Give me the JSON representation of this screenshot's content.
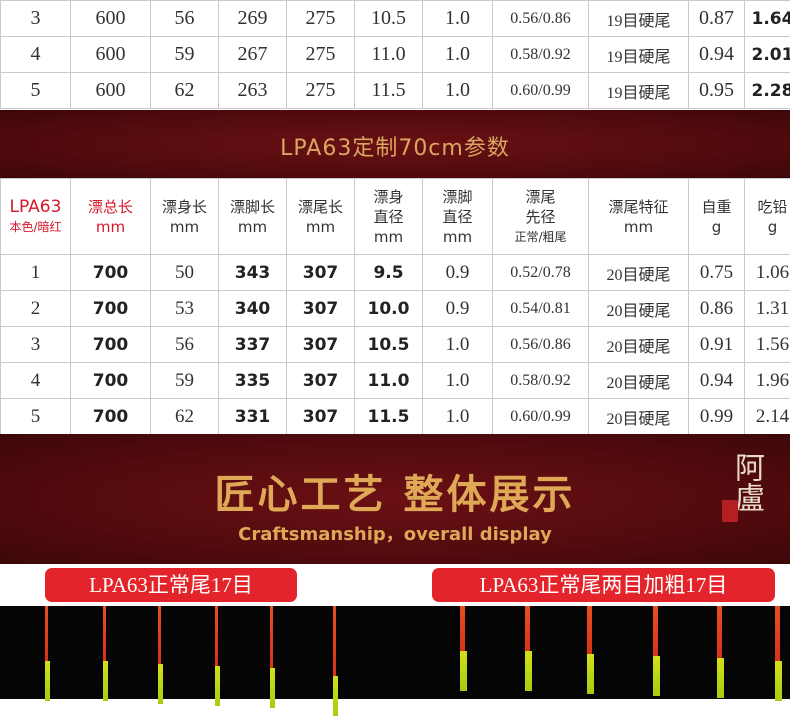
{
  "top_table": {
    "rows": [
      [
        "3",
        "600",
        "56",
        "269",
        "275",
        "10.5",
        "1.0",
        "0.56/0.86",
        "19目硬尾",
        "0.87",
        "1.64"
      ],
      [
        "4",
        "600",
        "59",
        "267",
        "275",
        "11.0",
        "1.0",
        "0.58/0.92",
        "19目硬尾",
        "0.94",
        "2.01"
      ],
      [
        "5",
        "600",
        "62",
        "263",
        "275",
        "11.5",
        "1.0",
        "0.60/0.99",
        "19目硬尾",
        "0.95",
        "2.28"
      ]
    ]
  },
  "section_title": "LPA63定制70cm参数",
  "spec_table": {
    "headers": {
      "model": "LPA63",
      "model_sub": "本色/暗红",
      "total_length": "漂总长",
      "total_length_unit": "mm",
      "body_length": "漂身长",
      "body_length_unit": "mm",
      "foot_length": "漂脚长",
      "foot_length_unit": "mm",
      "tail_length": "漂尾长",
      "tail_length_unit": "mm",
      "body_diameter_1": "漂身",
      "body_diameter_2": "直径",
      "body_diameter_unit": "mm",
      "foot_diameter_1": "漂脚",
      "foot_diameter_2": "直径",
      "foot_diameter_unit": "mm",
      "tail_tip_1": "漂尾",
      "tail_tip_2": "先径",
      "tail_tip_sub": "正常/粗尾",
      "tail_feature": "漂尾特征",
      "tail_feature_unit": "mm",
      "weight": "自重",
      "weight_unit": "g",
      "lead": "吃铅",
      "lead_unit": "g"
    },
    "rows": [
      [
        "1",
        "700",
        "50",
        "343",
        "307",
        "9.5",
        "0.9",
        "0.52/0.78",
        "20目硬尾",
        "0.75",
        "1.06"
      ],
      [
        "2",
        "700",
        "53",
        "340",
        "307",
        "10.0",
        "0.9",
        "0.54/0.81",
        "20目硬尾",
        "0.86",
        "1.31"
      ],
      [
        "3",
        "700",
        "56",
        "337",
        "307",
        "10.5",
        "1.0",
        "0.56/0.86",
        "20目硬尾",
        "0.91",
        "1.56"
      ],
      [
        "4",
        "700",
        "59",
        "335",
        "307",
        "11.0",
        "1.0",
        "0.58/0.92",
        "20目硬尾",
        "0.94",
        "1.96"
      ],
      [
        "5",
        "700",
        "62",
        "331",
        "307",
        "11.5",
        "1.0",
        "0.60/0.99",
        "20目硬尾",
        "0.99",
        "2.14"
      ]
    ]
  },
  "craft": {
    "title_cn": "匠心工艺 整体展示",
    "title_en": "Craftsmanship，overall display",
    "seal_text": "阿盧"
  },
  "labels": {
    "left": "LPA63正常尾17目",
    "right": "LPA63正常尾两目加粗17目"
  },
  "colors": {
    "accent_red": "#e3242a",
    "band_dark_red": "#4e0a0d",
    "gold": "#dfa857",
    "header_red": "#d5192c"
  }
}
